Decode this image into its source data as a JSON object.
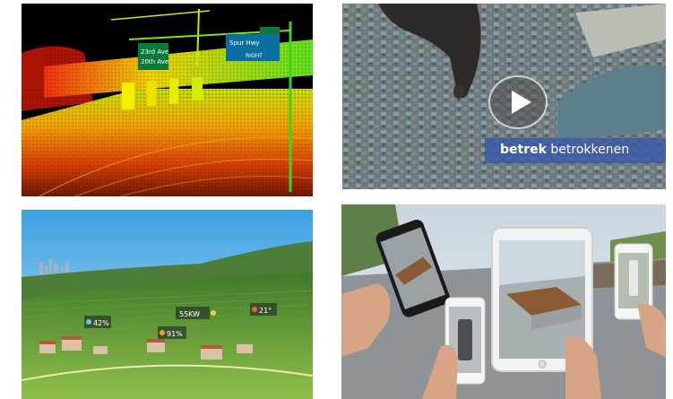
{
  "tiles": {
    "lidar": {
      "signs": {
        "left_line1": "23rd Ave",
        "left_line2": "20th Ave",
        "right_line1": "Spur Hwy",
        "right_line2": "RIGHT"
      }
    },
    "map_video": {
      "caption_bold": "betrek",
      "caption_rest": "betrokkenen"
    },
    "vineyard": {
      "badges": [
        "42%",
        "55KW",
        "91%",
        "21°"
      ]
    },
    "ar": {}
  }
}
